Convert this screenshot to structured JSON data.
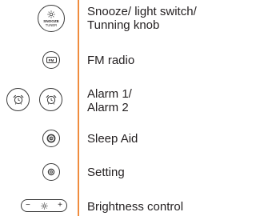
{
  "rows": [
    {
      "lines": [
        "Snooze/ light switch/",
        "Tunning knob"
      ],
      "icon": "sun-icon"
    },
    {
      "lines": [
        "FM radio"
      ],
      "icon": "fm-icon"
    },
    {
      "lines": [
        "Alarm 1/",
        "Alarm 2"
      ],
      "icon": "alarm-clock-icon"
    },
    {
      "lines": [
        "Sleep Aid"
      ],
      "icon": "sleep-aid-icon"
    },
    {
      "lines": [
        "Setting"
      ],
      "icon": "settings-icon"
    },
    {
      "lines": [
        "Brightness control"
      ],
      "icon": "brightness-slider-icon"
    }
  ],
  "snooze_knob": {
    "line1": "SNOOZE",
    "line2": "TUNER"
  },
  "fm_button": {
    "text": "FM"
  },
  "brightness_control": {
    "minus": "−",
    "plus": "+"
  },
  "colors": {
    "divider": "#f08c3e",
    "text": "#231f20",
    "outline": "#3a3a3a"
  }
}
